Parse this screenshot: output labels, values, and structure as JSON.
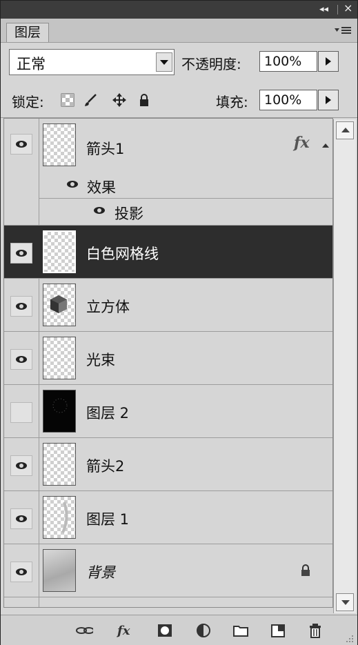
{
  "window": {
    "collapse_glyph": "◂◂",
    "close_glyph": "×"
  },
  "tab": {
    "label": "图层"
  },
  "blend_mode": {
    "value": "正常"
  },
  "opacity": {
    "label": "不透明度:",
    "value": "100%"
  },
  "lock": {
    "label": "锁定:",
    "icons": [
      "lock-transparent-icon",
      "lock-brush-icon",
      "lock-move-icon",
      "lock-all-icon"
    ]
  },
  "fill": {
    "label": "填充:",
    "value": "100%"
  },
  "layers": [
    {
      "name": "箭头1",
      "visible": true,
      "has_fx": true,
      "fx_label": "fx",
      "effects_label": "效果",
      "effects": [
        "投影"
      ]
    },
    {
      "name": "白色网格线",
      "visible": true,
      "selected": true
    },
    {
      "name": "立方体",
      "visible": true
    },
    {
      "name": "光束",
      "visible": true
    },
    {
      "name": "图层 2",
      "visible": false
    },
    {
      "name": "箭头2",
      "visible": true
    },
    {
      "name": "图层 1",
      "visible": true
    },
    {
      "name": "背景",
      "visible": true,
      "locked": true
    }
  ],
  "bottom_bar": {
    "icons": [
      "link-layers-icon",
      "add-layer-style-icon",
      "add-mask-icon",
      "adjustment-layer-icon",
      "new-group-icon",
      "new-layer-icon",
      "delete-layer-icon"
    ]
  },
  "colors": {
    "panel_bg": "#d6d6d6",
    "selected_row": "#2d2d2d",
    "titlebar": "#3c3c3c"
  }
}
